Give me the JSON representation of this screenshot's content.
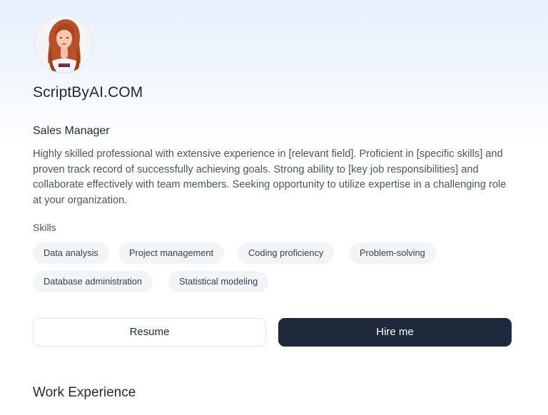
{
  "profile": {
    "brand": "ScriptByAI.COM",
    "role": "Sales Manager",
    "bio": "Highly skilled professional with extensive experience in [relevant field]. Proficient in [specific skills] and proven track record of successfully achieving goals. Strong ability to [key job responsibilities] and collaborate effectively with team members. Seeking opportunity to utilize expertise in a challenging role at your organization."
  },
  "skills": {
    "label": "Skills",
    "items": [
      "Data analysis",
      "Project management",
      "Coding proficiency",
      "Problem-solving",
      "Database administration",
      "Statistical modeling"
    ]
  },
  "actions": {
    "resume_label": "Resume",
    "hire_label": "Hire me"
  },
  "sections": {
    "work_title": "Work Experience"
  },
  "colors": {
    "primary_button": "#1e293b",
    "chip_background": "#f3f4f6"
  }
}
